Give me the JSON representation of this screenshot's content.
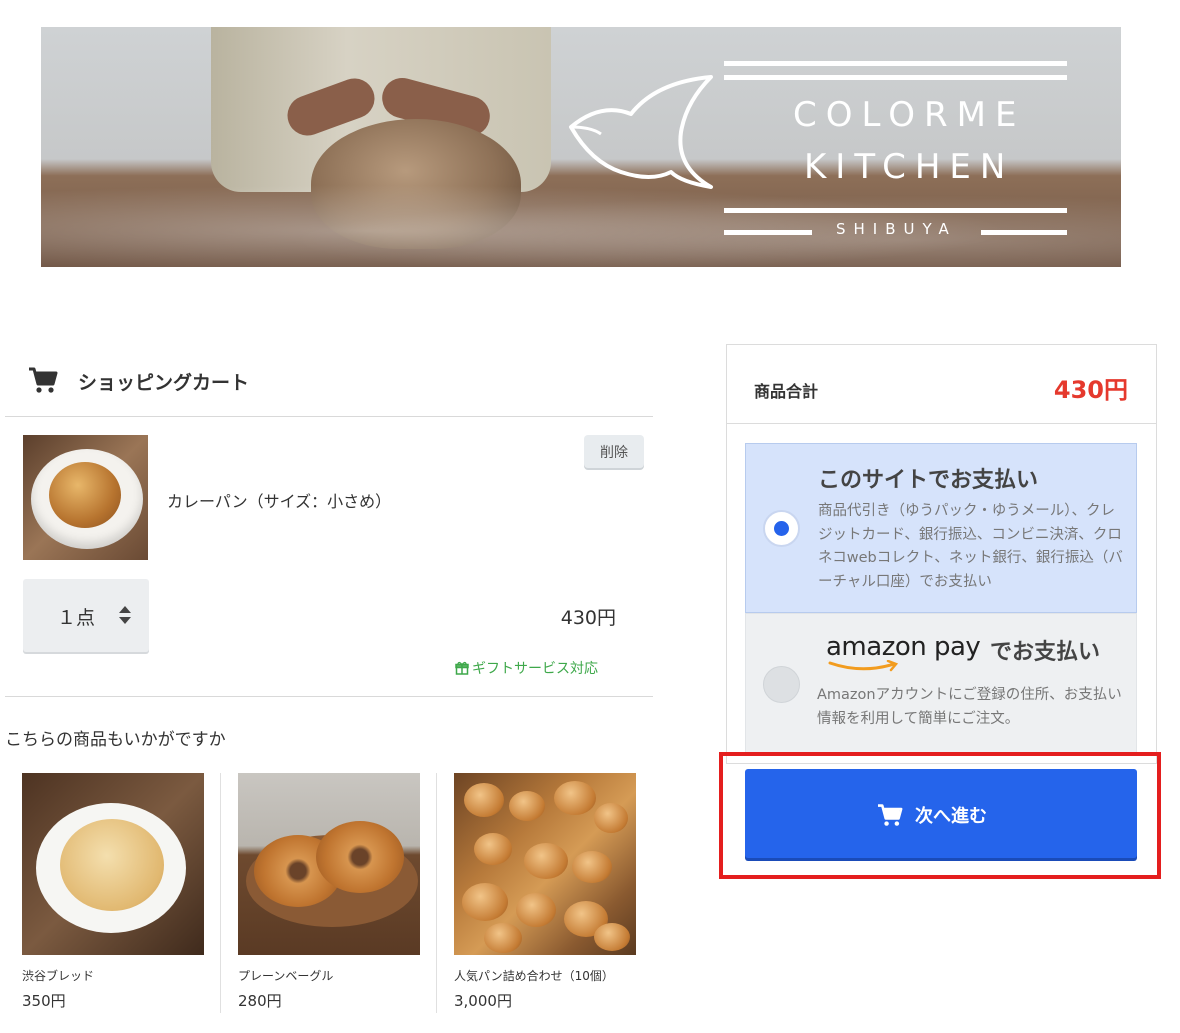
{
  "banner": {
    "logo_line1": "COLORME",
    "logo_line2": "KITCHEN",
    "logo_sub": "SHIBUYA"
  },
  "cart": {
    "title": "ショッピングカート",
    "item": {
      "name": "カレーパン（サイズ：小さめ）",
      "delete_label": "削除",
      "quantity": "１点",
      "price": "430円",
      "gift_label": "ギフトサービス対応"
    }
  },
  "recommendations": {
    "title": "こちらの商品もいかがですか",
    "items": [
      {
        "name": "渋谷ブレッド",
        "price": "350円"
      },
      {
        "name": "プレーンベーグル",
        "price": "280円"
      },
      {
        "name": "人気パン詰め合わせ（10個）",
        "price": "3,000円"
      }
    ]
  },
  "summary": {
    "subtotal_label": "商品合計",
    "subtotal_value": "430円"
  },
  "payment": {
    "options": [
      {
        "title": "このサイトでお支払い",
        "description": "商品代引き（ゆうパック・ゆうメール）、クレジットカード、銀行振込、コンビニ決済、クロネコwebコレクト、ネット銀行、銀行振込（バーチャル口座）でお支払い",
        "selected": true
      },
      {
        "logo_text": "amazon pay",
        "title_suffix": "でお支払い",
        "description": "Amazonアカウントにご登録の住所、お支払い情報を利用して簡単にご注文。",
        "selected": false
      }
    ],
    "next_label": "次へ進む"
  },
  "colors": {
    "accent": "#2564eb",
    "price_red": "#e5392d",
    "highlight_red": "#e41e1e",
    "gift_green": "#3ea84a"
  },
  "icons": [
    "cart-icon",
    "gift-icon",
    "bird-logo-icon",
    "qty-arrows-icon"
  ]
}
